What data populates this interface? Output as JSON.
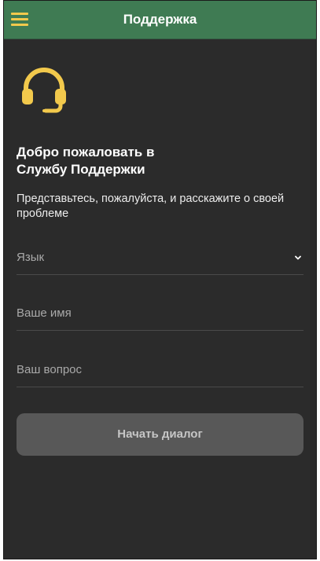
{
  "header": {
    "title": "Поддержка",
    "menu_icon": "hamburger-menu-icon",
    "background_color": "#3f7b53",
    "accent_color": "#f2c94c"
  },
  "hero": {
    "icon": "headset-support-icon",
    "welcome_line1": "Добро пожаловать в",
    "welcome_line2": "Службу Поддержки",
    "intro": "Представьтесь, пожалуйста, и расскажите о своей проблеме"
  },
  "form": {
    "language_label": "Язык",
    "language_icon": "chevron-down-icon",
    "name_placeholder": "Ваше имя",
    "question_placeholder": "Ваш вопрос",
    "start_button": "Начать диалог"
  }
}
